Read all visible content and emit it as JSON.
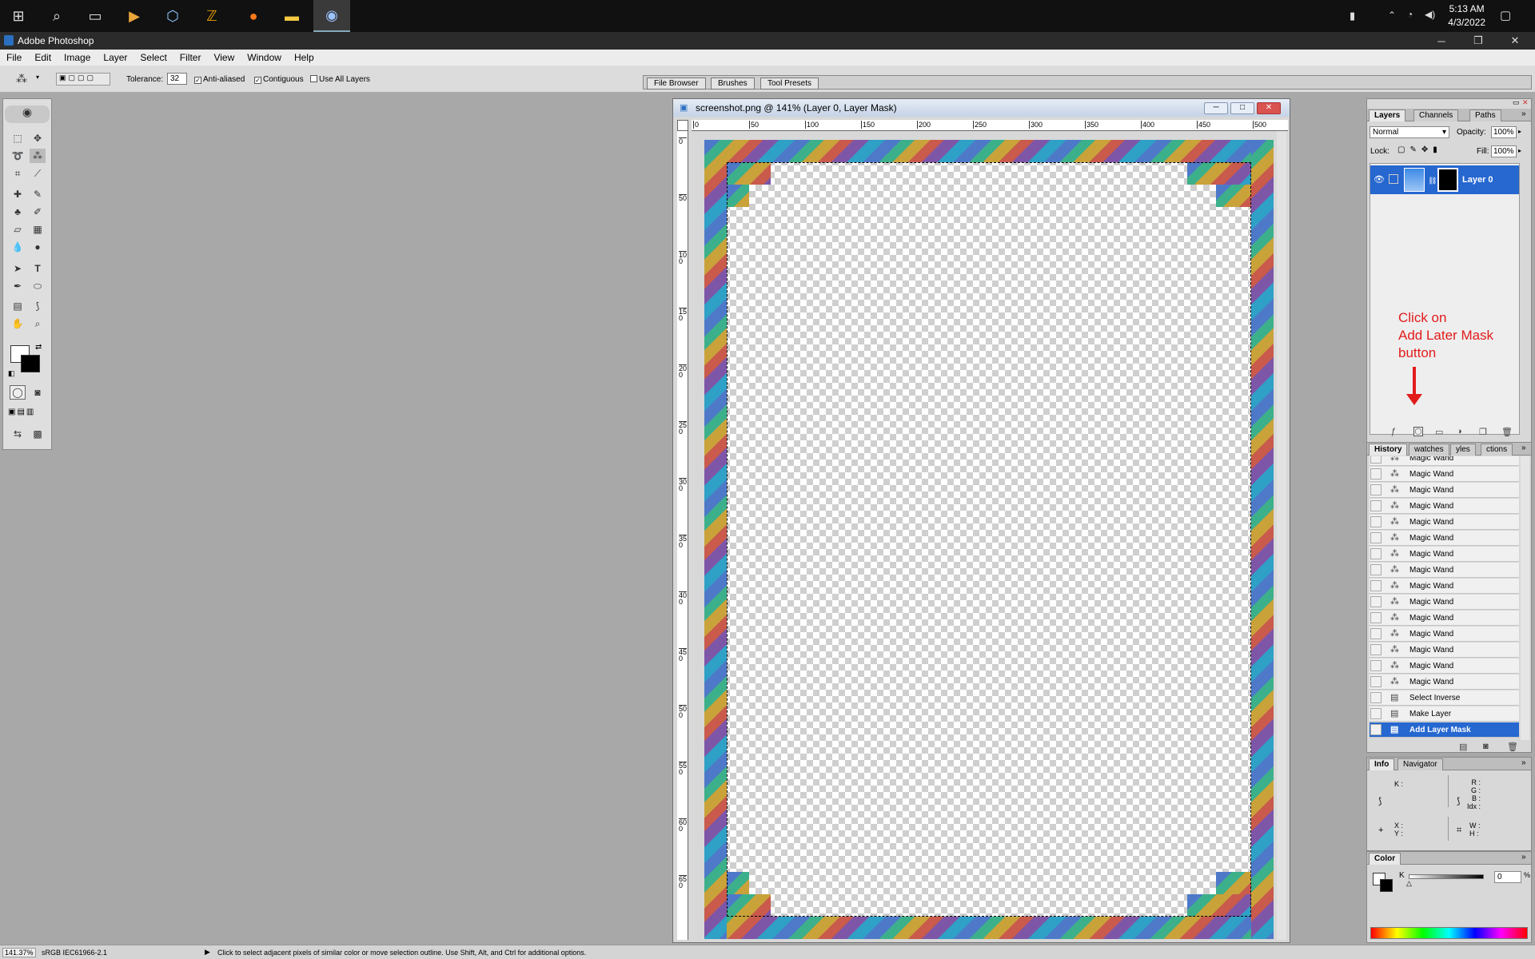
{
  "taskbar": {
    "clock_time": "5:13 AM",
    "clock_date": "4/3/2022",
    "icons": [
      "windows-start-icon",
      "search-icon",
      "task-view-icon",
      "media-player-icon",
      "virtualbox-icon",
      "filezilla-icon",
      "firefox-icon",
      "file-explorer-icon",
      "photoshop-icon"
    ]
  },
  "app": {
    "title": "Adobe Photoshop"
  },
  "menu": [
    "File",
    "Edit",
    "Image",
    "Layer",
    "Select",
    "Filter",
    "View",
    "Window",
    "Help"
  ],
  "options": {
    "tolerance_label": "Tolerance:",
    "tolerance_value": "32",
    "anti_aliased": "Anti-aliased",
    "contiguous": "Contiguous",
    "use_all_layers": "Use All Layers"
  },
  "palette_well": [
    "File Browser",
    "Brushes",
    "Tool Presets"
  ],
  "document": {
    "title": "screenshot.png @ 141% (Layer 0, Layer Mask)",
    "ruler_top": [
      "0",
      "50",
      "100",
      "150",
      "200",
      "250",
      "300",
      "350",
      "400",
      "450",
      "500"
    ],
    "ruler_left": [
      "0",
      "50",
      "100",
      "150",
      "200",
      "250",
      "300",
      "350",
      "400",
      "450",
      "500",
      "550",
      "600",
      "650"
    ]
  },
  "layers_panel": {
    "tabs": [
      "Layers",
      "Channels",
      "Paths"
    ],
    "blend_mode": "Normal",
    "opacity_label": "Opacity:",
    "opacity_value": "100%",
    "lock_label": "Lock:",
    "fill_label": "Fill:",
    "fill_value": "100%",
    "layer_name": "Layer 0"
  },
  "annotation": {
    "line1": "Click on",
    "line2": "Add Later Mask",
    "line3": "button",
    "color": "#e21b1b"
  },
  "history_panel": {
    "tabs": [
      "History",
      "Swatches",
      "Styles",
      "Actions"
    ],
    "tab_texts": [
      "History",
      "watches",
      "yles",
      "ctions"
    ],
    "partial_top": "Magic Wand",
    "items": [
      "Magic Wand",
      "Magic Wand",
      "Magic Wand",
      "Magic Wand",
      "Magic Wand",
      "Magic Wand",
      "Magic Wand",
      "Magic Wand",
      "Magic Wand",
      "Magic Wand",
      "Magic Wand",
      "Magic Wand",
      "Magic Wand",
      "Magic Wand",
      "Select Inverse",
      "Make Layer",
      "Add Layer Mask"
    ]
  },
  "info_panel": {
    "tabs": [
      "Info",
      "Navigator"
    ],
    "k": "K :",
    "r": "R :",
    "g": "G :",
    "b": "B :",
    "idx": "Idx :",
    "x": "X :",
    "y": "Y :",
    "w": "W :",
    "h": "H :"
  },
  "color_panel": {
    "tab": "Color",
    "k": "K",
    "value": "0",
    "unit": "%"
  },
  "status": {
    "zoom": "141.37%",
    "profile": "sRGB IEC61966-2.1",
    "message": "Click to select adjacent pixels of similar color or move selection outline.  Use Shift, Alt, and Ctrl for additional options."
  }
}
